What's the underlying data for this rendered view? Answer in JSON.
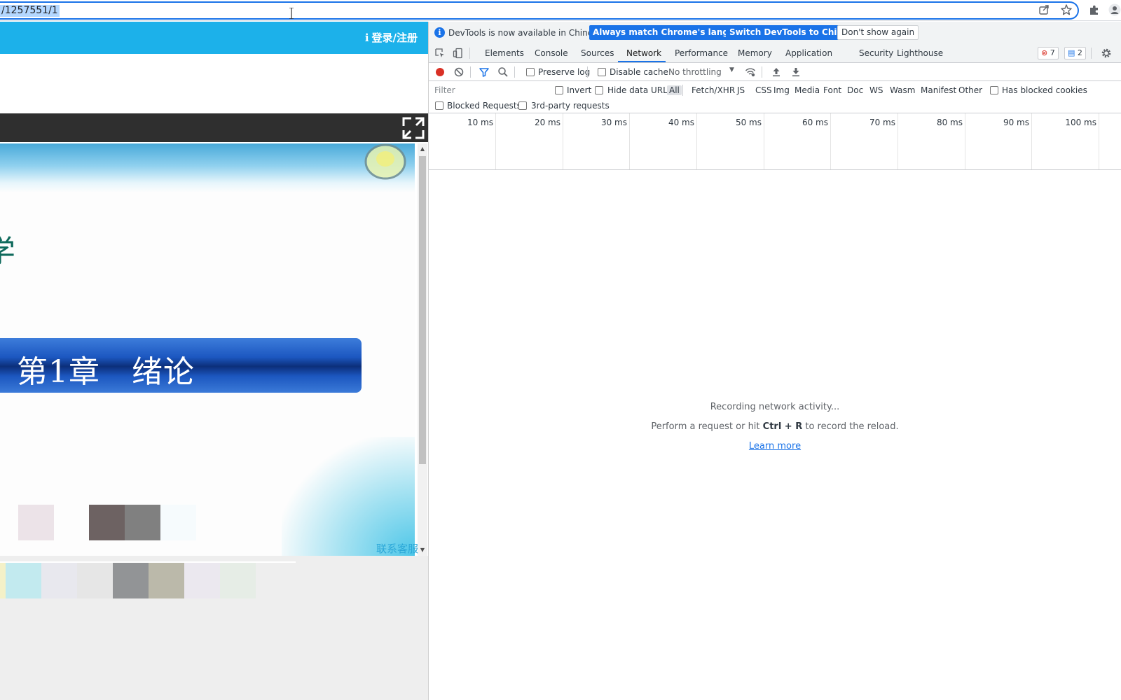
{
  "browser": {
    "url": "/1257551/1",
    "icons": [
      "share-icon",
      "bookmark-star-icon",
      "extensions-puzzle-icon",
      "profile-avatar-icon"
    ]
  },
  "page": {
    "header": {
      "login_label": "登录/注册"
    },
    "slide": {
      "partial_char": "学",
      "chapter_title": "第1章   绪论"
    },
    "contact_label": "联系客服",
    "colors": {
      "header": "#1cb1ea",
      "toolbar": "#2f2f2f",
      "banner": "#1c57c0",
      "contact": "#2ba7d8"
    }
  },
  "devtools": {
    "infobar": {
      "message": "DevTools is now available in Chinese!",
      "match_language_label": "Always match Chrome's language",
      "switch_label": "Switch DevTools to Chinese",
      "dismiss_label": "Don't show again"
    },
    "tabs": [
      "Elements",
      "Console",
      "Sources",
      "Network",
      "Performance",
      "Memory",
      "Application",
      "Security",
      "Lighthouse"
    ],
    "active_tab": "Network",
    "error_count": "7",
    "message_count": "2",
    "toolbar": {
      "preserve_log": "Preserve log",
      "disable_cache": "Disable cache",
      "throttling": "No throttling"
    },
    "filter": {
      "placeholder": "Filter",
      "invert": "Invert",
      "hide_data_urls": "Hide data URLs",
      "types": [
        "All",
        "Fetch/XHR",
        "JS",
        "CSS",
        "Img",
        "Media",
        "Font",
        "Doc",
        "WS",
        "Wasm",
        "Manifest",
        "Other"
      ],
      "has_blocked_cookies": "Has blocked cookies",
      "blocked_requests": "Blocked Requests",
      "third_party": "3rd-party requests"
    },
    "timeline_ticks": [
      "10 ms",
      "20 ms",
      "30 ms",
      "40 ms",
      "50 ms",
      "60 ms",
      "70 ms",
      "80 ms",
      "90 ms",
      "100 ms"
    ],
    "empty": {
      "recording": "Recording network activity...",
      "hint_prefix": "Perform a request or hit ",
      "hint_keys": "Ctrl + R",
      "hint_suffix": " to record the reload.",
      "learn_more": "Learn more"
    },
    "colors": {
      "accent": "#1a73e8",
      "record": "#d93025"
    }
  }
}
